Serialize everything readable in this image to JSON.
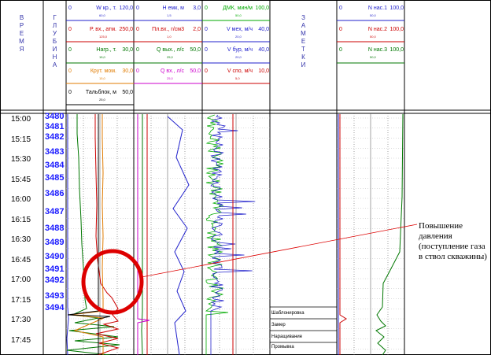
{
  "header": {
    "vremya": "В\nР\nЕ\nМ\nЯ",
    "glubina": "Г\nЛ\nУ\nБ\nИ\nН\nА",
    "zametki": "З\nА\nМ\nЕ\nТ\nК\nИ"
  },
  "tracks": {
    "t1": [
      {
        "min": "0",
        "label": "W кр., т.",
        "max": "120,0",
        "tick": "60,0",
        "color": "#2222cc"
      },
      {
        "min": "0",
        "label": "Р. вх., атм.",
        "max": "250,0",
        "tick": "125,0",
        "color": "#cc0000"
      },
      {
        "min": "0",
        "label": "Нагр., т.",
        "max": "30,0",
        "tick": "15,0",
        "color": "#007700"
      },
      {
        "min": "0",
        "label": "Крут. мом.",
        "max": "30,0",
        "tick": "15,0",
        "color": "#e07b00"
      },
      {
        "min": "0",
        "label": "Тальблок, м",
        "max": "50,0",
        "tick": "25,0",
        "color": "#000000"
      }
    ],
    "t2": [
      {
        "min": "0",
        "label": "Н емк, м",
        "max": "3,0",
        "tick": "1,5",
        "color": "#2222cc"
      },
      {
        "min": "0",
        "label": "Пл.вх., г/см3",
        "max": "2,0",
        "tick": "1,0",
        "color": "#cc0000"
      },
      {
        "min": "0",
        "label": "Q вых., л/с",
        "max": "50,0",
        "tick": "25,0",
        "color": "#007700"
      },
      {
        "min": "0",
        "label": "Q вх., л/с",
        "max": "50,0",
        "tick": "25,0",
        "color": "#cc00cc"
      }
    ],
    "t3": [
      {
        "min": "0",
        "label": "ДМК, мин/м",
        "max": "100,0",
        "tick": "50,0",
        "color": "#00aa00"
      },
      {
        "min": "0",
        "label": "V мех, м/ч",
        "max": "40,0",
        "tick": "20,0",
        "color": "#2222cc"
      },
      {
        "min": "0",
        "label": "V бур, м/ч",
        "max": "40,0",
        "tick": "20,0",
        "color": "#2222cc"
      },
      {
        "min": "0",
        "label": "V спо, м/ч",
        "max": "10,0",
        "tick": "5,0",
        "color": "#cc0000"
      }
    ],
    "t4": [
      {
        "min": "0",
        "label": "N нас.1",
        "max": "100,0",
        "tick": "50,0",
        "color": "#2222cc"
      },
      {
        "min": "0",
        "label": "N нас.2",
        "max": "100,0",
        "tick": "50,0",
        "color": "#cc0000"
      },
      {
        "min": "0",
        "label": "N нас.3",
        "max": "100,0",
        "tick": "50,0",
        "color": "#007700"
      }
    ]
  },
  "times": [
    "15:00",
    "15:15",
    "15:30",
    "15:45",
    "16:00",
    "16:15",
    "16:30",
    "16:45",
    "17:00",
    "17:15",
    "17:30",
    "17:45"
  ],
  "depths": [
    "3480",
    "3481",
    "3482",
    "3483",
    "3484",
    "3485",
    "3486",
    "3487",
    "3488",
    "3489",
    "3490",
    "3491",
    "3492",
    "3493",
    "3494"
  ],
  "notes": [
    "Шаблонировка",
    "Замер",
    "Наращивание",
    "Промывка"
  ],
  "callout": "Повышение давления (поступление газа в ствол скважины)"
}
